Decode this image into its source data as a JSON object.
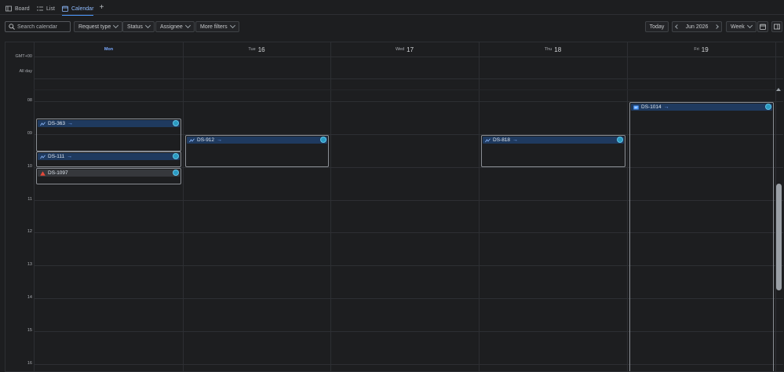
{
  "tabs": [
    {
      "label": "Board",
      "icon": "board-icon"
    },
    {
      "label": "List",
      "icon": "list-icon"
    },
    {
      "label": "Calendar",
      "icon": "calendar-icon",
      "active": true
    }
  ],
  "toolbar": {
    "search_placeholder": "Search calendar",
    "filters": [
      "Request type",
      "Status",
      "Assignee",
      "More filters"
    ],
    "today_label": "Today",
    "period_label": "Jun 2026",
    "view_label": "Week"
  },
  "calendar": {
    "timezone_label": "GMT+00",
    "all_day_label": "All day",
    "days": [
      {
        "name": "Mon",
        "num": "",
        "today": true
      },
      {
        "name": "Tue",
        "num": "16"
      },
      {
        "name": "Wed",
        "num": "17"
      },
      {
        "name": "Thu",
        "num": "18"
      },
      {
        "name": "Fri",
        "num": "19"
      }
    ],
    "hours": [
      "08",
      "09",
      "10",
      "11",
      "12",
      "13",
      "14",
      "15",
      "16"
    ],
    "events": [
      {
        "key": "DS-363",
        "day": 0,
        "icon": "change-icon",
        "variant": "normal"
      },
      {
        "key": "DS-111",
        "day": 0,
        "icon": "change-icon",
        "variant": "normal"
      },
      {
        "key": "DS-1097",
        "day": 0,
        "icon": "warning-icon",
        "variant": "incident"
      },
      {
        "key": "DS-912",
        "day": 1,
        "icon": "change-icon",
        "variant": "normal"
      },
      {
        "key": "DS-818",
        "day": 3,
        "icon": "change-icon",
        "variant": "normal"
      },
      {
        "key": "DS-1014",
        "day": 4,
        "icon": "service-request-icon",
        "variant": "normal"
      }
    ]
  },
  "colors": {
    "accent": "#4c9aff",
    "event_bar": "#1f3a5f",
    "avatar": "#2b9ac2",
    "warning": "#e5493a"
  }
}
